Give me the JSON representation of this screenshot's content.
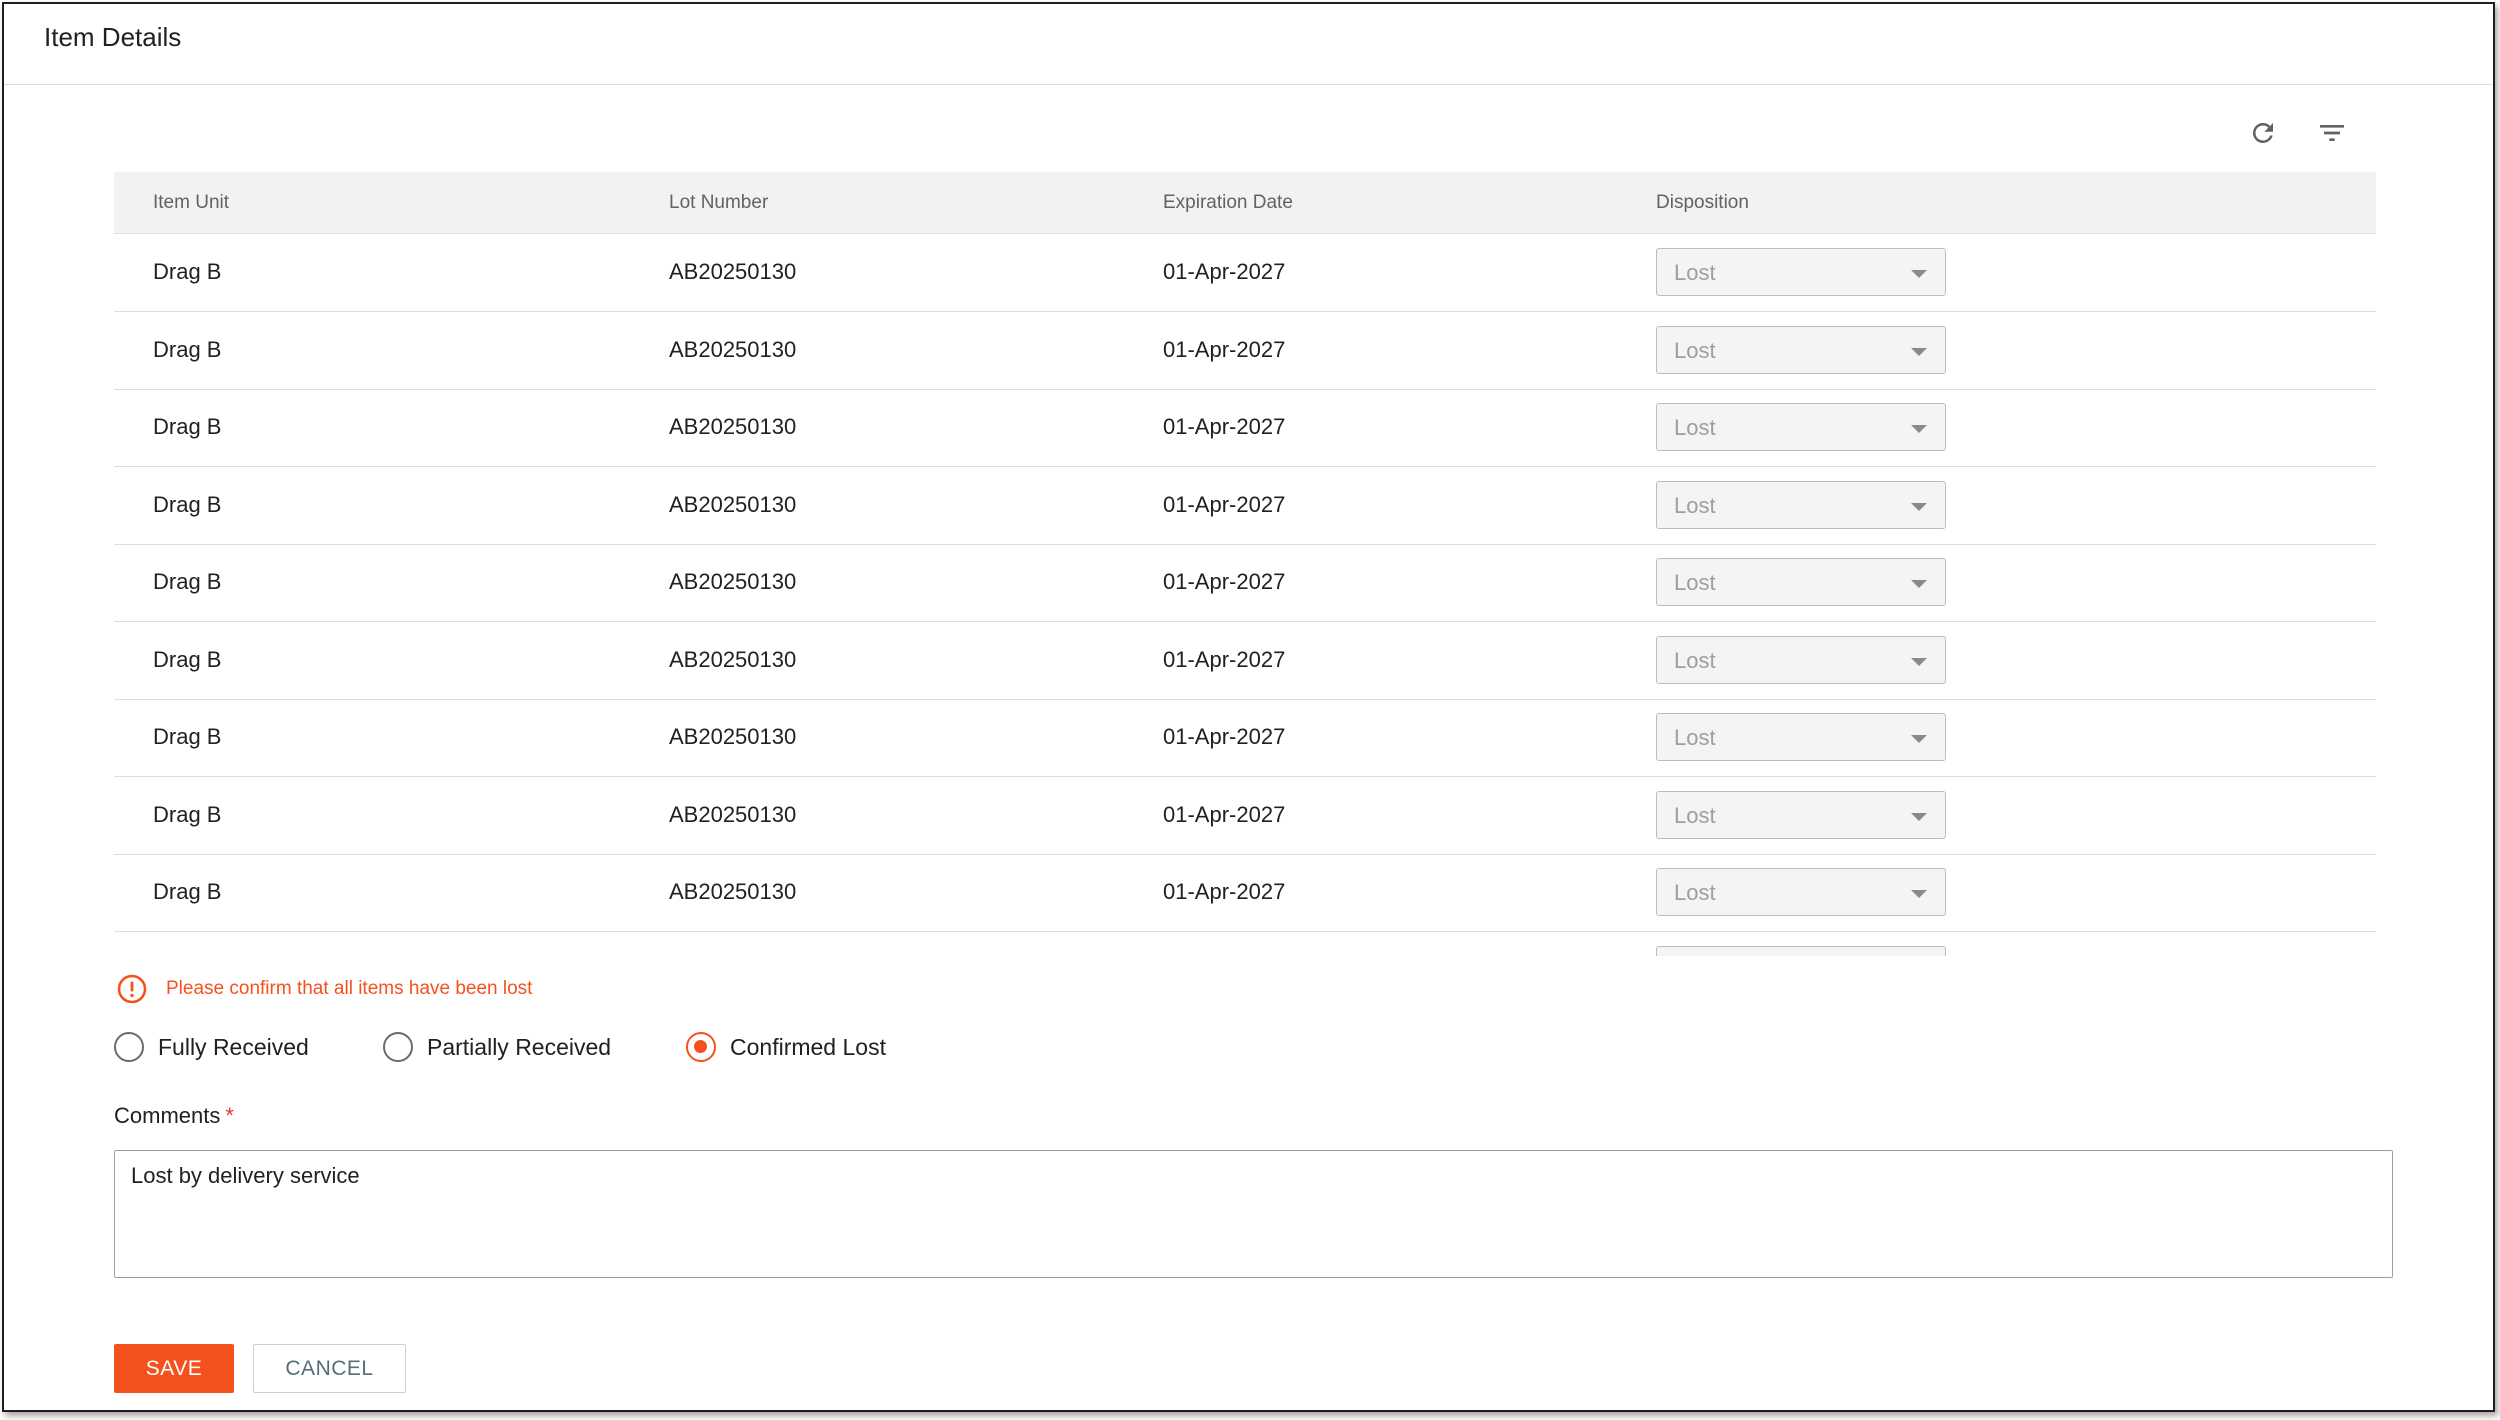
{
  "window": {
    "title": "Item Details"
  },
  "toolbar": {
    "refresh_icon": "refresh-icon",
    "filter_icon": "filter-icon"
  },
  "table": {
    "columns": [
      "Item Unit",
      "Lot Number",
      "Expiration Date",
      "Disposition"
    ],
    "rows": [
      {
        "item_unit": "Drag B",
        "lot_number": "AB20250130",
        "expiration_date": "01-Apr-2027",
        "disposition": "Lost"
      },
      {
        "item_unit": "Drag B",
        "lot_number": "AB20250130",
        "expiration_date": "01-Apr-2027",
        "disposition": "Lost"
      },
      {
        "item_unit": "Drag B",
        "lot_number": "AB20250130",
        "expiration_date": "01-Apr-2027",
        "disposition": "Lost"
      },
      {
        "item_unit": "Drag B",
        "lot_number": "AB20250130",
        "expiration_date": "01-Apr-2027",
        "disposition": "Lost"
      },
      {
        "item_unit": "Drag B",
        "lot_number": "AB20250130",
        "expiration_date": "01-Apr-2027",
        "disposition": "Lost"
      },
      {
        "item_unit": "Drag B",
        "lot_number": "AB20250130",
        "expiration_date": "01-Apr-2027",
        "disposition": "Lost"
      },
      {
        "item_unit": "Drag B",
        "lot_number": "AB20250130",
        "expiration_date": "01-Apr-2027",
        "disposition": "Lost"
      },
      {
        "item_unit": "Drag B",
        "lot_number": "AB20250130",
        "expiration_date": "01-Apr-2027",
        "disposition": "Lost"
      },
      {
        "item_unit": "Drag B",
        "lot_number": "AB20250130",
        "expiration_date": "01-Apr-2027",
        "disposition": "Lost"
      }
    ]
  },
  "warning": {
    "icon": "alert-circle-icon",
    "message": "Please confirm that all items have been lost"
  },
  "receipt_status": {
    "options": [
      "Fully Received",
      "Partially Received",
      "Confirmed Lost"
    ],
    "selected": "Confirmed Lost"
  },
  "comments": {
    "label": "Comments",
    "required_marker": "*",
    "value": "Lost by delivery service"
  },
  "actions": {
    "save_label": "SAVE",
    "cancel_label": "CANCEL"
  },
  "colors": {
    "accent": "#f4511e",
    "warning_text": "#f4511e",
    "required": "#e53935",
    "header_bg": "#f2f2f2",
    "cancel_text": "#546e7a"
  }
}
